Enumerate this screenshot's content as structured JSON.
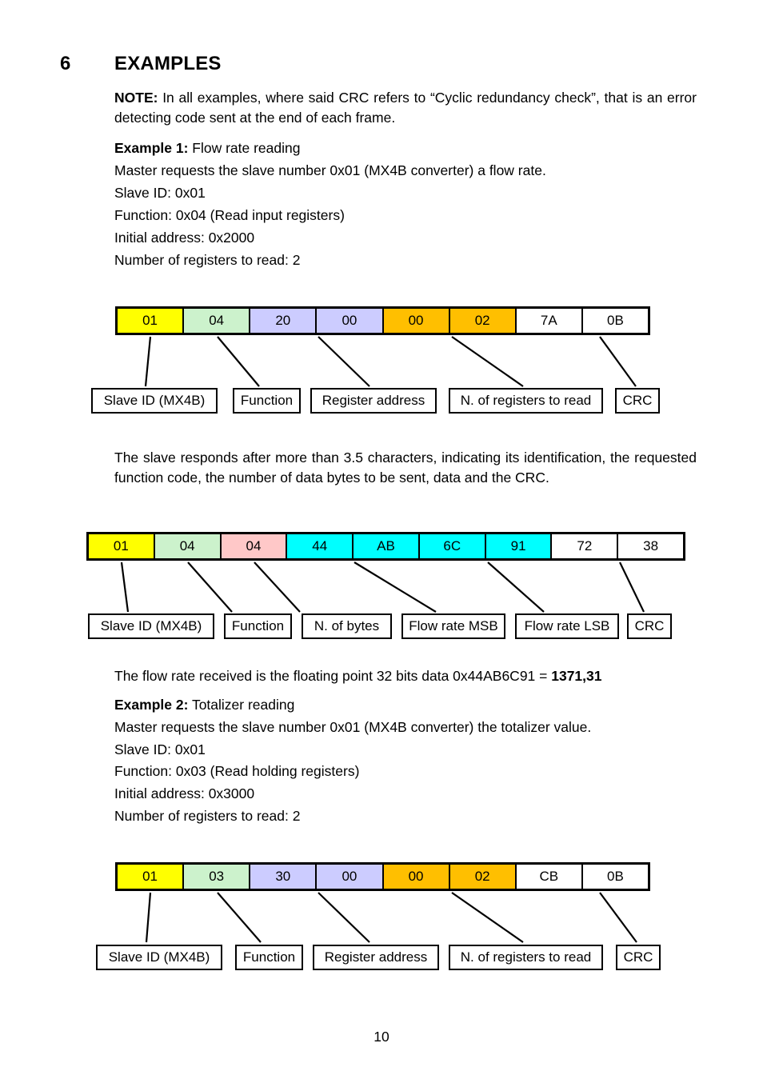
{
  "document": {
    "section_number": "6",
    "section_title": "EXAMPLES",
    "page_number": "10"
  },
  "note": {
    "label": "NOTE:",
    "text": " In all examples, where said CRC refers to “Cyclic redundancy check”, that is an error detecting code sent at the end of each frame."
  },
  "example1": {
    "label": "Example 1:",
    "title": " Flow rate reading",
    "request_intro": "Master requests the slave number 0x01 (MX4B converter) a flow rate.",
    "slave_id": "Slave ID: 0x01",
    "function": "Function: 0x04 (Read input registers)",
    "initial_address": "Initial address: 0x2000",
    "registers": "Number of registers to read: 2",
    "response_para": "The slave responds after more than 3.5 characters, indicating its identification, the requested function code, the number of data bytes to be sent, data and the CRC.",
    "result_prefix": "The flow rate received is the floating point 32 bits data  0x44AB6C91  = ",
    "result_value": "1371,31"
  },
  "example2": {
    "label": "Example 2:",
    "title": " Totalizer reading",
    "request_intro": "Master requests the slave number 0x01 (MX4B converter) the totalizer value.",
    "slave_id": "Slave ID: 0x01",
    "function": "Function: 0x03 (Read holding registers)",
    "initial_address": "Initial address: 0x3000",
    "registers": "Number of registers to read: 2"
  },
  "colors": {
    "yellow": "#FFFF00",
    "light_green": "#CCF2CC",
    "light_purple": "#CCCCFF",
    "orange": "#FFBF00",
    "pink": "#FFC8C8",
    "cyan": "#00FFFF",
    "white": "#FFFFFF"
  },
  "frames": [
    {
      "name": "request-frame-flow-rate",
      "cells": [
        {
          "value": "01",
          "color": "#FFFF00"
        },
        {
          "value": "04",
          "color": "#CCF2CC"
        },
        {
          "value": "20",
          "color": "#CCCCFF"
        },
        {
          "value": "00",
          "color": "#CCCCFF"
        },
        {
          "value": "00",
          "color": "#FFBF00"
        },
        {
          "value": "02",
          "color": "#FFBF00"
        },
        {
          "value": "7A",
          "color": "#FFFFFF"
        },
        {
          "value": "0B",
          "color": "#FFFFFF"
        }
      ],
      "labels": [
        "Slave ID (MX4B)",
        "Function",
        "Register address",
        "N. of registers to read",
        "CRC"
      ]
    },
    {
      "name": "response-frame-flow-rate",
      "cells": [
        {
          "value": "01",
          "color": "#FFFF00"
        },
        {
          "value": "04",
          "color": "#CCF2CC"
        },
        {
          "value": "04",
          "color": "#FFC8C8"
        },
        {
          "value": "44",
          "color": "#00FFFF"
        },
        {
          "value": "AB",
          "color": "#00FFFF"
        },
        {
          "value": "6C",
          "color": "#00FFFF"
        },
        {
          "value": "91",
          "color": "#00FFFF"
        },
        {
          "value": "72",
          "color": "#FFFFFF"
        },
        {
          "value": "38",
          "color": "#FFFFFF"
        }
      ],
      "labels": [
        "Slave ID (MX4B)",
        "Function",
        "N. of bytes",
        "Flow rate MSB",
        "Flow rate LSB",
        "CRC"
      ]
    },
    {
      "name": "request-frame-totalizer",
      "cells": [
        {
          "value": "01",
          "color": "#FFFF00"
        },
        {
          "value": "03",
          "color": "#CCF2CC"
        },
        {
          "value": "30",
          "color": "#CCCCFF"
        },
        {
          "value": "00",
          "color": "#CCCCFF"
        },
        {
          "value": "00",
          "color": "#FFBF00"
        },
        {
          "value": "02",
          "color": "#FFBF00"
        },
        {
          "value": "CB",
          "color": "#FFFFFF"
        },
        {
          "value": "0B",
          "color": "#FFFFFF"
        }
      ],
      "labels": [
        "Slave ID (MX4B)",
        "Function",
        "Register address",
        "N. of registers to read",
        "CRC"
      ]
    }
  ]
}
